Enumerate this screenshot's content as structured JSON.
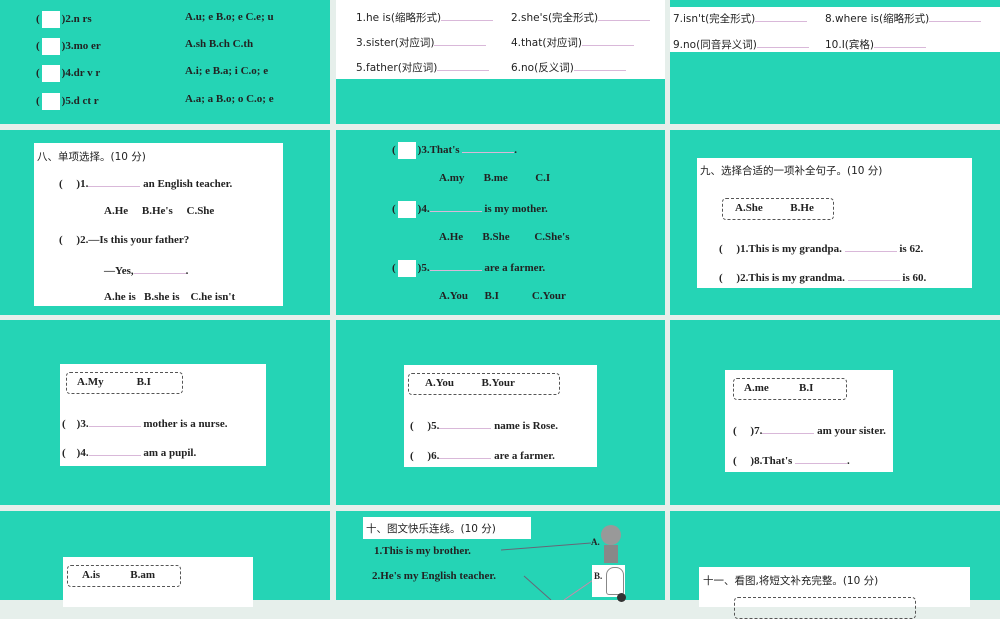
{
  "slide1": {
    "items": [
      {
        "q": ")2.n    rs",
        "opts": "A.u; e  B.o; e  C.e; u"
      },
      {
        "q": ")3.mo        er",
        "opts": "A.sh    B.ch    C.th"
      },
      {
        "q": ")4.dr    v    r",
        "opts": "A.i; e  B.a; i  C.o; e"
      },
      {
        "q": ")5.d    ct    r",
        "opts": "A.a; a  B.o; o  C.o; e"
      }
    ]
  },
  "slide2": {
    "items": [
      "1.he is(缩略形式)",
      "2.she's(完全形式)",
      "3.sister(对应词)",
      "4.that(对应词)",
      "5.father(对应词)",
      "6.no(反义词)"
    ]
  },
  "slide3": {
    "items": [
      "7.isn't(完全形式)",
      "8.where is(缩略形式)",
      "9.no(同音异义词)",
      "10.I(宾格)"
    ]
  },
  "slide4": {
    "title": "八、单项选择。(10 分)",
    "q1": ")1.",
    "q1b": "an English teacher.",
    "o1": "A.He     B.He's     C.She",
    "q2": ")2.—Is this your father?",
    "q2b": "—Yes,",
    "o2": "A.he is   B.she is    C.he isn't"
  },
  "slide5": {
    "q3": ")3.That's",
    "o3": "A.my       B.me          C.I",
    "q4": ")4.",
    "q4b": "is my mother.",
    "o4": "A.He       B.She         C.She's",
    "q5": ")5.",
    "q5b": "are a farmer.",
    "o5": "A.You      B.I            C.Your"
  },
  "slide6": {
    "title": "九、选择合适的一项补全句子。(10 分)",
    "box": "A.She          B.He",
    "q1": ")1.This is my grandpa.",
    "q1b": "is 62.",
    "q2": ")2.This is my grandma.",
    "q2b": "is 60."
  },
  "slide7": {
    "box": "A.My            B.I",
    "q3": ")3.",
    "q3b": "mother is a nurse.",
    "q4": ")4.",
    "q4b": "am a pupil."
  },
  "slide8": {
    "box": "A.You          B.Your",
    "q5": ")5.",
    "q5b": "name is Rose.",
    "q6": ")6.",
    "q6b": "are a farmer."
  },
  "slide9": {
    "box": "A.me           B.I",
    "q7": ")7.",
    "q7b": "am your sister.",
    "q8": ")8.That's"
  },
  "slide10": {
    "box": "A.is           B.am"
  },
  "slide11": {
    "title": "十、图文快乐连线。(10 分)",
    "l1": "1.This is my brother.",
    "l2": "2.He's my English teacher.",
    "a": "A.",
    "b": "B."
  },
  "slide12": {
    "title": "十一、看图,将短文补充完整。(10 分)"
  }
}
